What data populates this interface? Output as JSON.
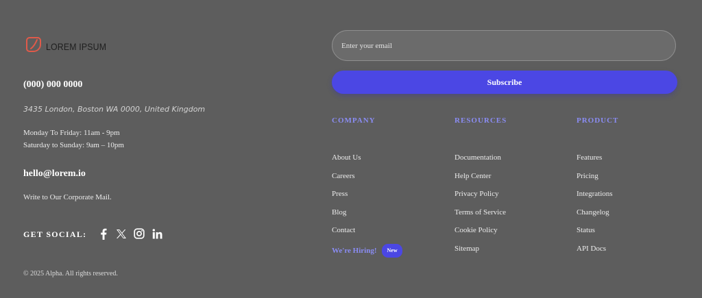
{
  "brand": {
    "name": "LOREM IPSUM",
    "accent_color": "#e05a4a"
  },
  "contact": {
    "phone": "(000) 000 0000",
    "address": "3435 London, Boston WA 0000, United Kingdom",
    "hours_weekday": "Monday To Friday: 11am - 9pm",
    "hours_weekend": "Saturday to Sunday: 9am – 10pm",
    "email": "hello@lorem.io",
    "email_note": "Write to Our Corporate Mail."
  },
  "social": {
    "label": "GET SOCIAL:",
    "icons": [
      "facebook-icon",
      "x-icon",
      "instagram-icon",
      "linkedin-icon"
    ]
  },
  "newsletter": {
    "placeholder": "Enter your email",
    "button_label": "Subscribe",
    "button_color": "#4b47e4"
  },
  "columns": [
    {
      "title": "COMPANY",
      "links": [
        "About Us",
        "Careers",
        "Press",
        "Blog",
        "Contact"
      ],
      "extra_link": "We're Hiring!",
      "extra_badge": "New"
    },
    {
      "title": "RESOURCES",
      "links": [
        "Documentation",
        "Help Center",
        "Privacy Policy",
        "Terms of Service",
        "Cookie Policy",
        "Sitemap"
      ]
    },
    {
      "title": "PRODUCT",
      "links": [
        "Features",
        "Pricing",
        "Integrations",
        "Changelog",
        "Status",
        "API Docs"
      ]
    }
  ],
  "copyright": "© 2025 Alpha. All rights reserved."
}
